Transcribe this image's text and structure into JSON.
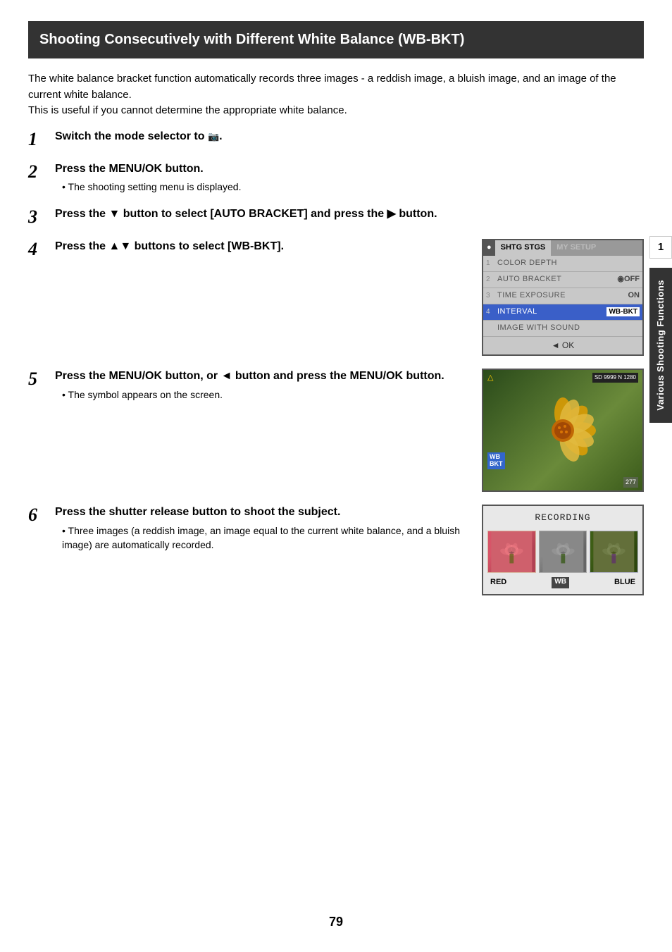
{
  "header": {
    "title": "Shooting Consecutively with Different White Balance (WB-BKT)"
  },
  "intro": {
    "line1": "The white balance bracket function automatically records three images - a reddish image, a bluish image, and an image of the current white balance.",
    "line2": "This is useful if you cannot determine the appropriate white balance."
  },
  "steps": [
    {
      "number": "1",
      "title": "Switch the mode selector to 📷.",
      "sub": null
    },
    {
      "number": "2",
      "title": "Press the MENU/OK button.",
      "sub": "The shooting setting menu is displayed."
    },
    {
      "number": "3",
      "title": "Press the ▼ button to select [AUTO BRACKET] and press the ► button.",
      "sub": null
    },
    {
      "number": "4",
      "title": "Press the ▲▼ buttons to select [WB-BKT].",
      "sub": null
    },
    {
      "number": "5",
      "title": "Press the MENU/OK button, or ◄ button and press the MENU/OK button.",
      "sub": "The symbol appears on the screen."
    },
    {
      "number": "6",
      "title": "Press the shutter release button to shoot the subject.",
      "sub": "Three images (a reddish image, an image equal to the current white balance, and a bluish image) are automatically recorded."
    }
  ],
  "menu_screen": {
    "tabs": [
      "SHTG STGS",
      "MY SETUP"
    ],
    "rows": [
      {
        "num": "",
        "label": "COLOR DEPTH",
        "value": ""
      },
      {
        "num": "2",
        "label": "AUTO BRACKET",
        "value": "OFF"
      },
      {
        "num": "3",
        "label": "TIME EXPOSURE",
        "value": "ON"
      },
      {
        "num": "4",
        "label": "INTERVAL",
        "value": "WB-BKT"
      },
      {
        "num": "",
        "label": "IMAGE WITH SOUND",
        "value": ""
      }
    ],
    "ok_label": "◄ OK"
  },
  "recording": {
    "title": "RECORDING",
    "labels": [
      "RED",
      "WB",
      "BLUE"
    ]
  },
  "sidebar": {
    "text": "Various Shooting Functions",
    "number": "1"
  },
  "page_number": "79"
}
